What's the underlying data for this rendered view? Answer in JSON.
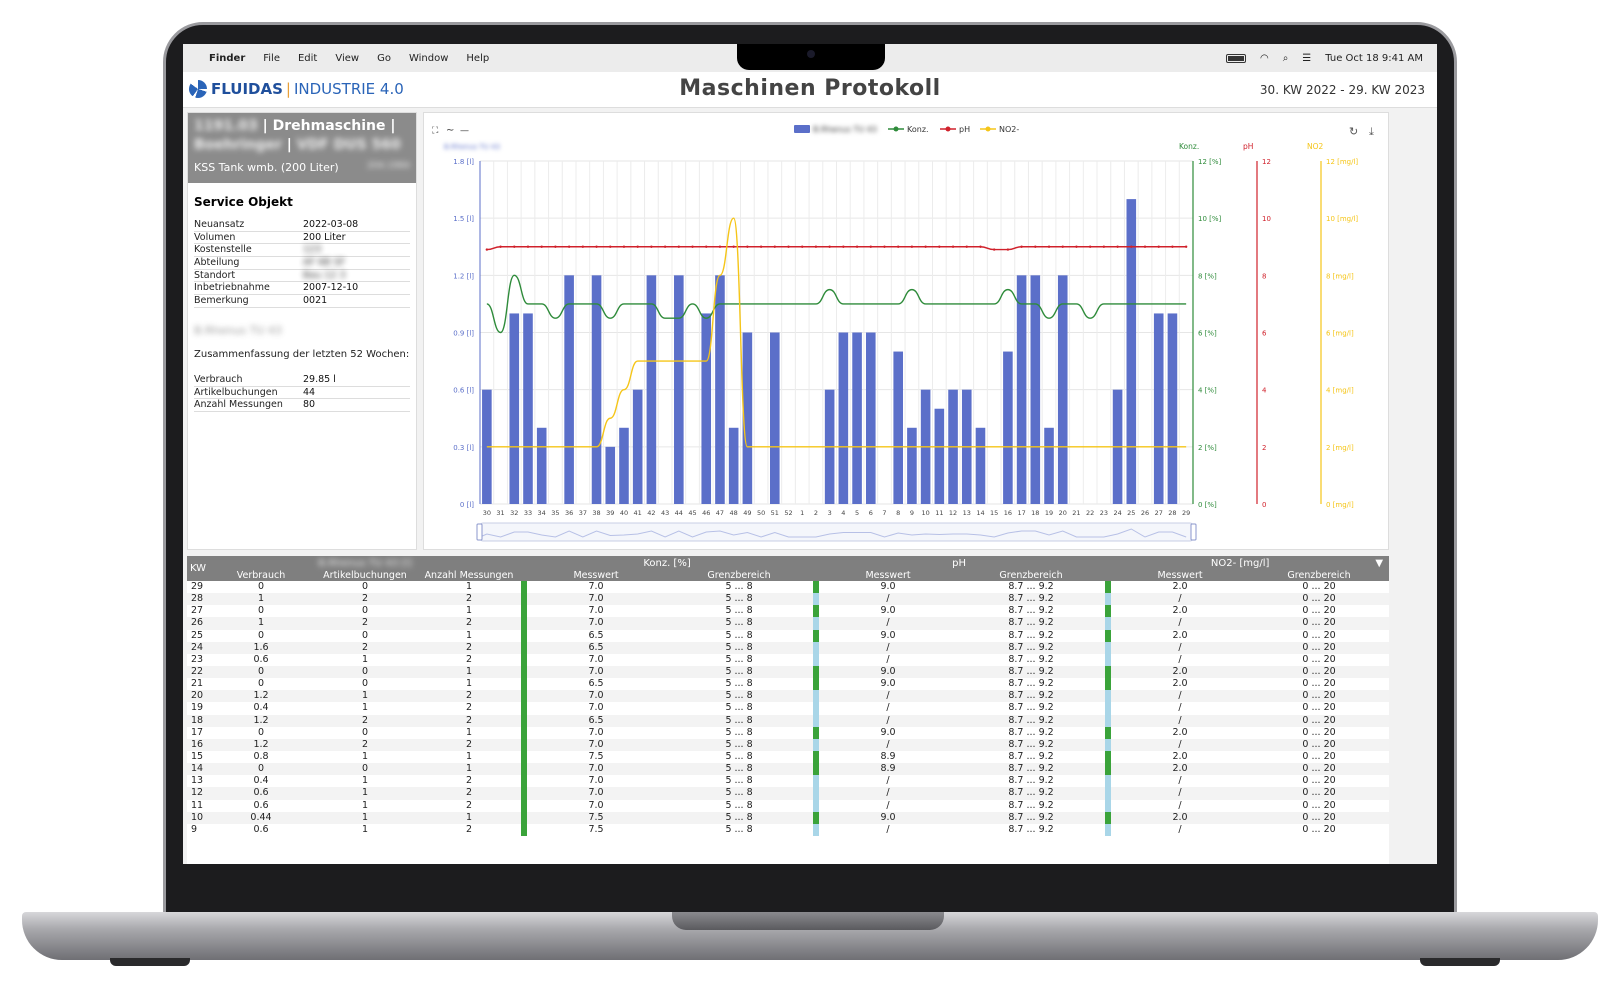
{
  "menubar": {
    "app": "Finder",
    "items": [
      "File",
      "Edit",
      "View",
      "Go",
      "Window",
      "Help"
    ],
    "clock": "Tue Oct 18  9:41 AM"
  },
  "header": {
    "logo_brand": "FLUIDAS",
    "logo_sep": "|",
    "logo_sub": "INDUSTRIE 4.0",
    "title": "Maschinen Protokoll",
    "date_range": "30. KW 2022 - 29. KW 2023"
  },
  "machine": {
    "id_blurred": "1191.03",
    "type": "Drehmaschine",
    "maker_blurred": "Boehringer",
    "model_blurred": "VDF DUS 560",
    "tank": "KSS Tank wmb. (200 Liter)",
    "tank_code_blurred": "204.1984"
  },
  "service": {
    "title": "Service Objekt",
    "fields": [
      {
        "k": "Neuansatz",
        "v": "2022-03-08",
        "blur": false
      },
      {
        "k": "Volumen",
        "v": "200 Liter",
        "blur": false
      },
      {
        "k": "Kostenstelle",
        "v": "123",
        "blur": true
      },
      {
        "k": "Abteilung",
        "v": "AF 6B SF",
        "blur": true
      },
      {
        "k": "Standort",
        "v": "Bau 12 3",
        "blur": true
      },
      {
        "k": "Inbetriebnahme",
        "v": "2007-12-10",
        "blur": false
      },
      {
        "k": "Bemerkung",
        "v": "0021",
        "blur": false
      }
    ]
  },
  "summary": {
    "product_blurred": "B.Rhenus TU 43",
    "caption": "Zusammenfassung der letzten 52 Wochen:",
    "fields": [
      {
        "k": "Verbrauch",
        "v": "29.85 l"
      },
      {
        "k": "Artikelbuchungen",
        "v": "44"
      },
      {
        "k": "Anzahl Messungen",
        "v": "80"
      }
    ]
  },
  "chart_data": {
    "type": "bar",
    "title": "",
    "legend": [
      "B.Rhenus TU 43",
      "Konz.",
      "pH",
      "NO2-"
    ],
    "legend_position": "top-center",
    "categories": [
      "30",
      "31",
      "32",
      "33",
      "34",
      "35",
      "36",
      "37",
      "38",
      "39",
      "40",
      "41",
      "42",
      "43",
      "44",
      "45",
      "46",
      "47",
      "48",
      "49",
      "50",
      "51",
      "52",
      "1",
      "2",
      "3",
      "4",
      "5",
      "6",
      "7",
      "8",
      "9",
      "10",
      "11",
      "12",
      "13",
      "14",
      "15",
      "16",
      "17",
      "18",
      "19",
      "20",
      "21",
      "22",
      "23",
      "24",
      "25",
      "26",
      "27",
      "28",
      "29"
    ],
    "series": [
      {
        "name": "B.Rhenus TU 43",
        "kind": "bar",
        "color": "#5b6fc9",
        "values": [
          0.6,
          0,
          1.0,
          1.0,
          0.4,
          0,
          1.2,
          0,
          1.2,
          0.3,
          0.4,
          0.6,
          1.2,
          0,
          1.2,
          0,
          1.0,
          1.2,
          0.4,
          0.9,
          0,
          0.9,
          0,
          0,
          0,
          0.6,
          0.9,
          0.9,
          0.9,
          0,
          0.8,
          0.4,
          0.6,
          0.5,
          0.6,
          0.6,
          0.4,
          0,
          0.8,
          1.2,
          1.2,
          0.4,
          1.2,
          0,
          0,
          0,
          0.6,
          1.6,
          0,
          1.0,
          1.0,
          0
        ]
      },
      {
        "name": "Konz.",
        "kind": "line",
        "color": "#2e8b3a",
        "values": [
          7.0,
          6.0,
          8.0,
          7.0,
          7.0,
          6.5,
          7.0,
          7.0,
          7.0,
          6.5,
          7.0,
          7.0,
          7.0,
          6.5,
          6.5,
          7.0,
          6.5,
          7.0,
          7.0,
          7.0,
          7.0,
          7.0,
          7.0,
          7.0,
          7.0,
          7.5,
          7.0,
          7.0,
          7.0,
          7.0,
          7.0,
          7.5,
          7.0,
          7.0,
          7.0,
          7.0,
          7.0,
          7.0,
          7.5,
          7.0,
          7.0,
          6.5,
          7.0,
          7.0,
          6.5,
          7.0,
          7.0,
          7.0,
          7.0,
          7.0,
          7.0,
          7.0
        ]
      },
      {
        "name": "pH",
        "kind": "line",
        "color": "#d0212b",
        "values": [
          8.9,
          9.0,
          9.0,
          9.0,
          9.0,
          9.0,
          9.0,
          9.0,
          9.0,
          9.0,
          9.0,
          9.0,
          9.0,
          9.0,
          9.0,
          9.0,
          9.0,
          9.0,
          9.0,
          9.0,
          9.0,
          9.0,
          9.0,
          9.0,
          9.0,
          9.0,
          9.0,
          9.0,
          9.0,
          9.0,
          9.0,
          9.0,
          9.0,
          9.0,
          9.0,
          9.0,
          9.0,
          8.9,
          8.9,
          9.0,
          9.0,
          9.0,
          9.0,
          9.0,
          9.0,
          9.0,
          9.0,
          9.0,
          9.0,
          9.0,
          9.0,
          9.0
        ]
      },
      {
        "name": "NO2-",
        "kind": "line",
        "color": "#f5c518",
        "values": [
          2,
          2,
          2,
          2,
          2,
          2,
          2,
          2,
          2,
          3,
          4,
          5,
          5,
          5,
          5,
          5,
          5,
          8,
          10,
          2,
          2,
          2,
          2,
          2,
          2,
          2,
          2,
          2,
          2,
          2,
          2,
          2,
          2,
          2,
          2,
          2,
          2,
          2,
          2,
          2,
          2,
          2,
          2,
          2,
          2,
          2,
          2,
          2,
          2,
          2,
          2,
          2
        ]
      }
    ],
    "axes": {
      "left": {
        "label": "B.Rhenus TU 43",
        "ticks": [
          "1.8 [l]",
          "1.5 [l]",
          "1.2 [l]",
          "0.9 [l]",
          "0.6 [l]",
          "0.3 [l]",
          "0 [l]"
        ],
        "ylim": [
          0,
          1.8
        ],
        "color": "#5b6fc9"
      },
      "konz": {
        "label": "Konz.",
        "ticks": [
          "12 [%]",
          "10 [%]",
          "8 [%]",
          "6 [%]",
          "4 [%]",
          "2 [%]",
          "0 [%]"
        ],
        "ylim": [
          0,
          12
        ],
        "color": "#2e8b3a"
      },
      "ph": {
        "label": "pH",
        "ticks": [
          "12",
          "10",
          "8",
          "6",
          "4",
          "2",
          "0"
        ],
        "ylim": [
          0,
          12
        ],
        "color": "#d0212b"
      },
      "no2": {
        "label": "NO2",
        "ticks": [
          "12 [mg/l]",
          "10 [mg/l]",
          "8 [mg/l]",
          "6 [mg/l]",
          "4 [mg/l]",
          "2 [mg/l]",
          "0 [mg/l]"
        ],
        "ylim": [
          0,
          12
        ],
        "color": "#f5c518"
      }
    },
    "grid": true
  },
  "table": {
    "headers": {
      "kw": "KW",
      "product_group": "B.Rhenus TU 43 [l]",
      "konz_group": "Konz. [%]",
      "ph_group": "pH",
      "no2_group": "NO2- [mg/l]",
      "verbrauch": "Verbrauch",
      "artikel": "Artikelbuchungen",
      "messungen": "Anzahl Messungen",
      "messwert": "Messwert",
      "grenzbereich": "Grenzbereich",
      "sort_icon": "▼"
    },
    "rows": [
      {
        "kw": "29",
        "verbrauch": "0",
        "artikel": "0",
        "mess": "1",
        "konz": "7.0",
        "konz_g": "5 ... 8",
        "ph": "9.0",
        "ph_g": "8.7 ... 9.2",
        "no2": "2.0",
        "no2_g": "0 ... 20"
      },
      {
        "kw": "28",
        "verbrauch": "1",
        "artikel": "2",
        "mess": "2",
        "konz": "7.0",
        "konz_g": "5 ... 8",
        "ph": "/",
        "ph_g": "8.7 ... 9.2",
        "no2": "/",
        "no2_g": "0 ... 20"
      },
      {
        "kw": "27",
        "verbrauch": "0",
        "artikel": "0",
        "mess": "1",
        "konz": "7.0",
        "konz_g": "5 ... 8",
        "ph": "9.0",
        "ph_g": "8.7 ... 9.2",
        "no2": "2.0",
        "no2_g": "0 ... 20"
      },
      {
        "kw": "26",
        "verbrauch": "1",
        "artikel": "2",
        "mess": "2",
        "konz": "7.0",
        "konz_g": "5 ... 8",
        "ph": "/",
        "ph_g": "8.7 ... 9.2",
        "no2": "/",
        "no2_g": "0 ... 20"
      },
      {
        "kw": "25",
        "verbrauch": "0",
        "artikel": "0",
        "mess": "1",
        "konz": "6.5",
        "konz_g": "5 ... 8",
        "ph": "9.0",
        "ph_g": "8.7 ... 9.2",
        "no2": "2.0",
        "no2_g": "0 ... 20"
      },
      {
        "kw": "24",
        "verbrauch": "1.6",
        "artikel": "2",
        "mess": "2",
        "konz": "6.5",
        "konz_g": "5 ... 8",
        "ph": "/",
        "ph_g": "8.7 ... 9.2",
        "no2": "/",
        "no2_g": "0 ... 20"
      },
      {
        "kw": "23",
        "verbrauch": "0.6",
        "artikel": "1",
        "mess": "2",
        "konz": "7.0",
        "konz_g": "5 ... 8",
        "ph": "/",
        "ph_g": "8.7 ... 9.2",
        "no2": "/",
        "no2_g": "0 ... 20"
      },
      {
        "kw": "22",
        "verbrauch": "0",
        "artikel": "0",
        "mess": "1",
        "konz": "7.0",
        "konz_g": "5 ... 8",
        "ph": "9.0",
        "ph_g": "8.7 ... 9.2",
        "no2": "2.0",
        "no2_g": "0 ... 20"
      },
      {
        "kw": "21",
        "verbrauch": "0",
        "artikel": "0",
        "mess": "1",
        "konz": "6.5",
        "konz_g": "5 ... 8",
        "ph": "9.0",
        "ph_g": "8.7 ... 9.2",
        "no2": "2.0",
        "no2_g": "0 ... 20"
      },
      {
        "kw": "20",
        "verbrauch": "1.2",
        "artikel": "1",
        "mess": "2",
        "konz": "7.0",
        "konz_g": "5 ... 8",
        "ph": "/",
        "ph_g": "8.7 ... 9.2",
        "no2": "/",
        "no2_g": "0 ... 20"
      },
      {
        "kw": "19",
        "verbrauch": "0.4",
        "artikel": "1",
        "mess": "2",
        "konz": "7.0",
        "konz_g": "5 ... 8",
        "ph": "/",
        "ph_g": "8.7 ... 9.2",
        "no2": "/",
        "no2_g": "0 ... 20"
      },
      {
        "kw": "18",
        "verbrauch": "1.2",
        "artikel": "2",
        "mess": "2",
        "konz": "6.5",
        "konz_g": "5 ... 8",
        "ph": "/",
        "ph_g": "8.7 ... 9.2",
        "no2": "/",
        "no2_g": "0 ... 20"
      },
      {
        "kw": "17",
        "verbrauch": "0",
        "artikel": "0",
        "mess": "1",
        "konz": "7.0",
        "konz_g": "5 ... 8",
        "ph": "9.0",
        "ph_g": "8.7 ... 9.2",
        "no2": "2.0",
        "no2_g": "0 ... 20"
      },
      {
        "kw": "16",
        "verbrauch": "1.2",
        "artikel": "2",
        "mess": "2",
        "konz": "7.0",
        "konz_g": "5 ... 8",
        "ph": "/",
        "ph_g": "8.7 ... 9.2",
        "no2": "/",
        "no2_g": "0 ... 20"
      },
      {
        "kw": "15",
        "verbrauch": "0.8",
        "artikel": "1",
        "mess": "1",
        "konz": "7.5",
        "konz_g": "5 ... 8",
        "ph": "8.9",
        "ph_g": "8.7 ... 9.2",
        "no2": "2.0",
        "no2_g": "0 ... 20"
      },
      {
        "kw": "14",
        "verbrauch": "0",
        "artikel": "0",
        "mess": "1",
        "konz": "7.0",
        "konz_g": "5 ... 8",
        "ph": "8.9",
        "ph_g": "8.7 ... 9.2",
        "no2": "2.0",
        "no2_g": "0 ... 20"
      },
      {
        "kw": "13",
        "verbrauch": "0.4",
        "artikel": "1",
        "mess": "2",
        "konz": "7.0",
        "konz_g": "5 ... 8",
        "ph": "/",
        "ph_g": "8.7 ... 9.2",
        "no2": "/",
        "no2_g": "0 ... 20"
      },
      {
        "kw": "12",
        "verbrauch": "0.6",
        "artikel": "1",
        "mess": "2",
        "konz": "7.0",
        "konz_g": "5 ... 8",
        "ph": "/",
        "ph_g": "8.7 ... 9.2",
        "no2": "/",
        "no2_g": "0 ... 20"
      },
      {
        "kw": "11",
        "verbrauch": "0.6",
        "artikel": "1",
        "mess": "2",
        "konz": "7.0",
        "konz_g": "5 ... 8",
        "ph": "/",
        "ph_g": "8.7 ... 9.2",
        "no2": "/",
        "no2_g": "0 ... 20"
      },
      {
        "kw": "10",
        "verbrauch": "0.44",
        "artikel": "1",
        "mess": "1",
        "konz": "7.5",
        "konz_g": "5 ... 8",
        "ph": "9.0",
        "ph_g": "8.7 ... 9.2",
        "no2": "2.0",
        "no2_g": "0 ... 20"
      },
      {
        "kw": "9",
        "verbrauch": "0.6",
        "artikel": "1",
        "mess": "2",
        "konz": "7.5",
        "konz_g": "5 ... 8",
        "ph": "/",
        "ph_g": "8.7 ... 9.2",
        "no2": "/",
        "no2_g": "0 ... 20"
      }
    ]
  },
  "colors": {
    "bar": "#5b6fc9",
    "konz": "#2e8b3a",
    "ph": "#d0212b",
    "no2": "#f5c518",
    "status_ok": "#3aa33a",
    "status_none": "#a9d6e8",
    "header_gray": "#7f7f7f"
  }
}
